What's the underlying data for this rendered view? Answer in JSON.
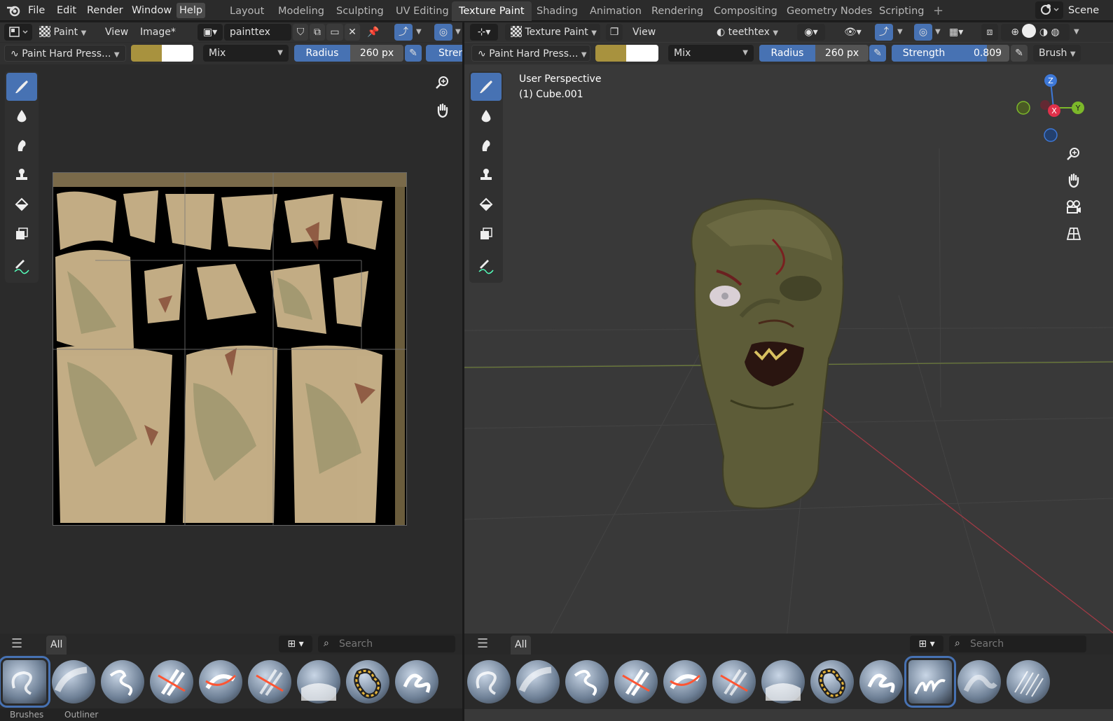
{
  "topbar": {
    "menus": [
      "File",
      "Edit",
      "Render",
      "Window",
      "Help"
    ],
    "workspaces": [
      "Layout",
      "Modeling",
      "Sculpting",
      "UV Editing",
      "Texture Paint",
      "Shading",
      "Animation",
      "Rendering",
      "Compositing",
      "Geometry Nodes",
      "Scripting"
    ],
    "active_workspace": "Texture Paint",
    "add_tab": "+",
    "scene_label": "Scene"
  },
  "image_editor": {
    "mode": "Paint",
    "view": "View",
    "image_menu": "Image*",
    "image_name": "painttex",
    "brush_name": "Paint Hard Press...",
    "primary_color": "#a8923e",
    "secondary_color": "#ffffff",
    "blend": "Mix",
    "radius_label": "Radius",
    "radius_value": "260 px",
    "strength_label_cut": "Stren",
    "asset_tab": "All",
    "search_placeholder": "Search"
  },
  "viewport": {
    "mode": "Texture Paint",
    "view": "View",
    "texture_slot": "teethtex",
    "brush_name": "Paint Hard Press...",
    "primary_color": "#a8923e",
    "secondary_color": "#ffffff",
    "blend": "Mix",
    "radius_label": "Radius",
    "radius_value": "260 px",
    "strength_label": "Strength",
    "strength_value": "0.809",
    "brush_menu": "Brush",
    "overlay_line1": "User Perspective",
    "overlay_line2": "(1) Cube.001",
    "gizmo": {
      "z": "Z",
      "x": "X",
      "y": "Y"
    },
    "asset_tab": "All",
    "search_placeholder": "Search"
  },
  "tools": [
    "brush-tool",
    "blur-tool",
    "smear-tool",
    "clone-tool",
    "fill-tool",
    "mask-tool",
    "annotate-tool"
  ],
  "left_brushes": [
    "brush-airbrush",
    "brush-blur",
    "brush-smear",
    "brush-erase-hard",
    "brush-erase-soft",
    "brush-erase-pressure",
    "brush-fill",
    "brush-mask",
    "brush-paint"
  ],
  "right_brushes": [
    "brush-airbrush",
    "brush-blur",
    "brush-smear",
    "brush-erase-hard",
    "brush-erase-soft",
    "brush-erase-pressure",
    "brush-fill",
    "brush-mask",
    "brush-paint",
    "brush-paint-hard-pressure",
    "brush-soft",
    "brush-texture"
  ],
  "bottom_cut": [
    "Brushes",
    "Outliner"
  ]
}
